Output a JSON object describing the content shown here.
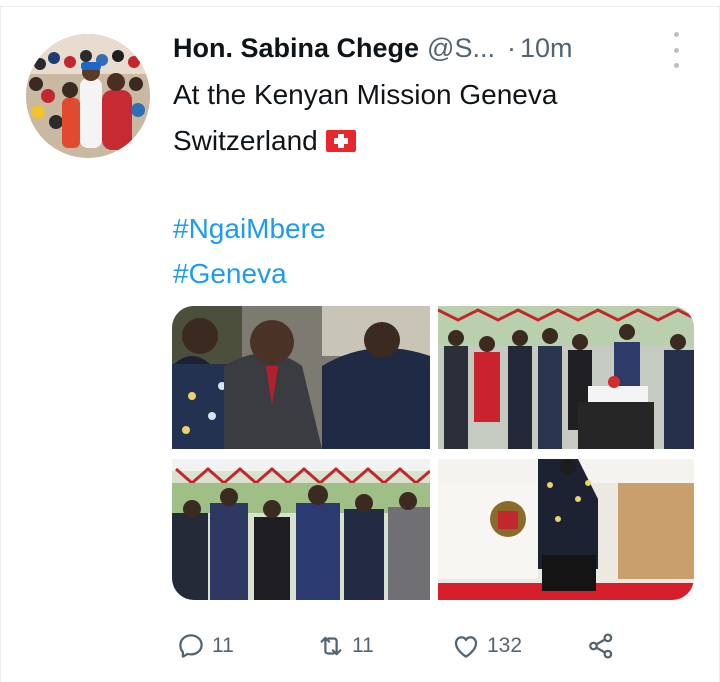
{
  "tweet": {
    "author_name": "Hon. Sabina Chege",
    "handle": "@S...",
    "separator": "·",
    "time": "10m",
    "text_line1": "At the Kenyan Mission Geneva",
    "text_line2": "Switzerland",
    "flag_icon": "swiss-flag-emoji",
    "hashtags": [
      "#NgaiMbere",
      "#Geneva"
    ],
    "photos": [
      {
        "desc_icon": "photo-icon"
      },
      {
        "desc_icon": "photo-icon"
      },
      {
        "desc_icon": "photo-icon"
      },
      {
        "desc_icon": "photo-icon"
      }
    ],
    "actions": {
      "reply_count": "11",
      "retweet_count": "11",
      "like_count": "132"
    }
  },
  "colors": {
    "link": "#1d9bf0",
    "muted": "#536471",
    "text": "#0f1419"
  }
}
